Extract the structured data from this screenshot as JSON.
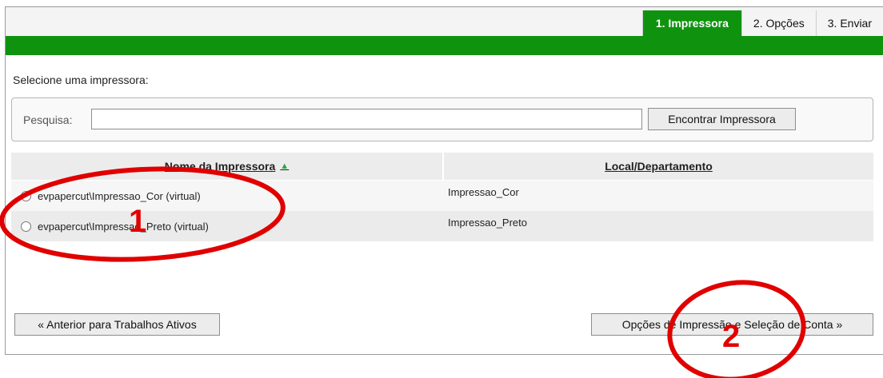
{
  "tabs": [
    {
      "label": "1. Impressora",
      "active": true
    },
    {
      "label": "2. Opções",
      "active": false
    },
    {
      "label": "3. Enviar",
      "active": false
    }
  ],
  "prompt": "Selecione uma impressora:",
  "search": {
    "label": "Pesquisa:",
    "value": "",
    "placeholder": "",
    "button_label": "Encontrar Impressora"
  },
  "table": {
    "columns": [
      {
        "label": "Nome da Impressora",
        "sort": "ascending"
      },
      {
        "label": "Local/Departamento"
      }
    ],
    "rows": [
      {
        "name": "evpapercut\\Impressao_Cor (virtual)",
        "location": "Impressao_Cor",
        "selected": false
      },
      {
        "name": "evpapercut\\Impressao_Preto (virtual)",
        "location": "Impressao_Preto",
        "selected": false
      }
    ]
  },
  "buttons": {
    "back_label": "« Anterior para Trabalhos Ativos",
    "next_label": "Opções de Impressão e Seleção de Conta »"
  },
  "annotations": {
    "marker_1": "1",
    "marker_2": "2",
    "color": "#e00000"
  },
  "colors": {
    "brand_green": "#0f930f",
    "sort_arrow": "#28a745"
  }
}
